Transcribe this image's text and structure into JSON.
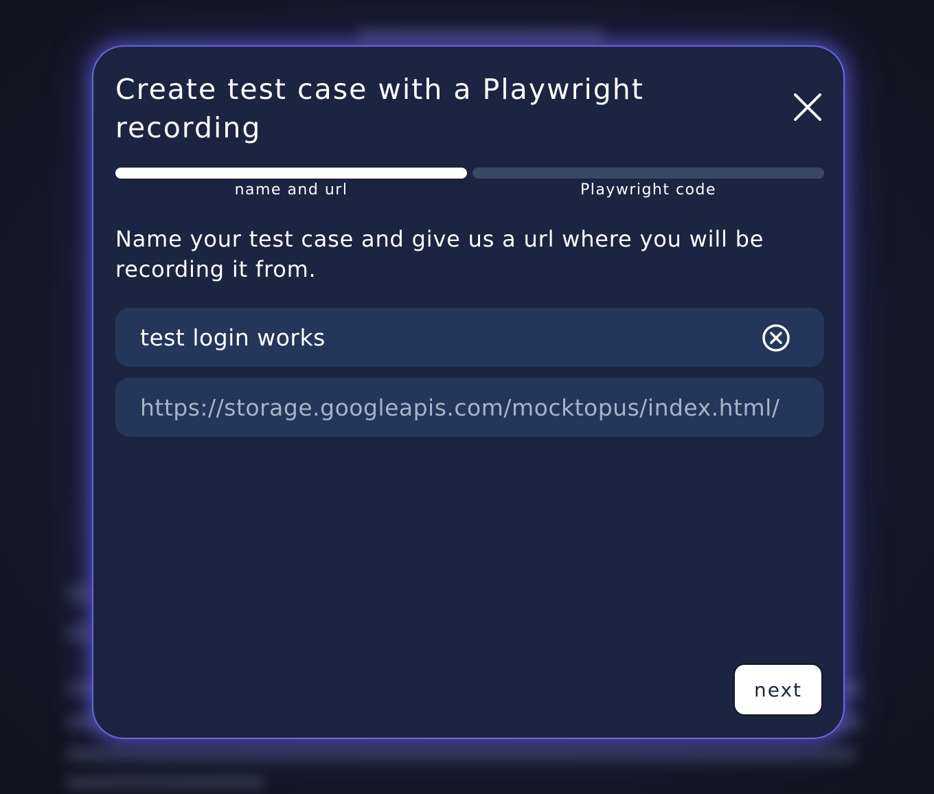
{
  "modal": {
    "title": "Create test case with a Playwright recording",
    "close_icon": "close-icon",
    "steps": [
      {
        "label": "name and url",
        "state": "active"
      },
      {
        "label": "Playwright code",
        "state": "inactive"
      }
    ],
    "description": "Name your test case and give us a url where you will be recording it from.",
    "name_field": {
      "value": "test login works",
      "clear_icon": "clear-circle-x-icon"
    },
    "url_field": {
      "value": "",
      "placeholder": "https://storage.googleapis.com/mocktopus/index.html/"
    },
    "next_label": "next"
  },
  "colors": {
    "modal_bg": "#1b2440",
    "modal_border": "#6a66e0",
    "field_bg": "#24365a",
    "progress_active": "#ffffff",
    "progress_inactive": "#3b4862"
  }
}
